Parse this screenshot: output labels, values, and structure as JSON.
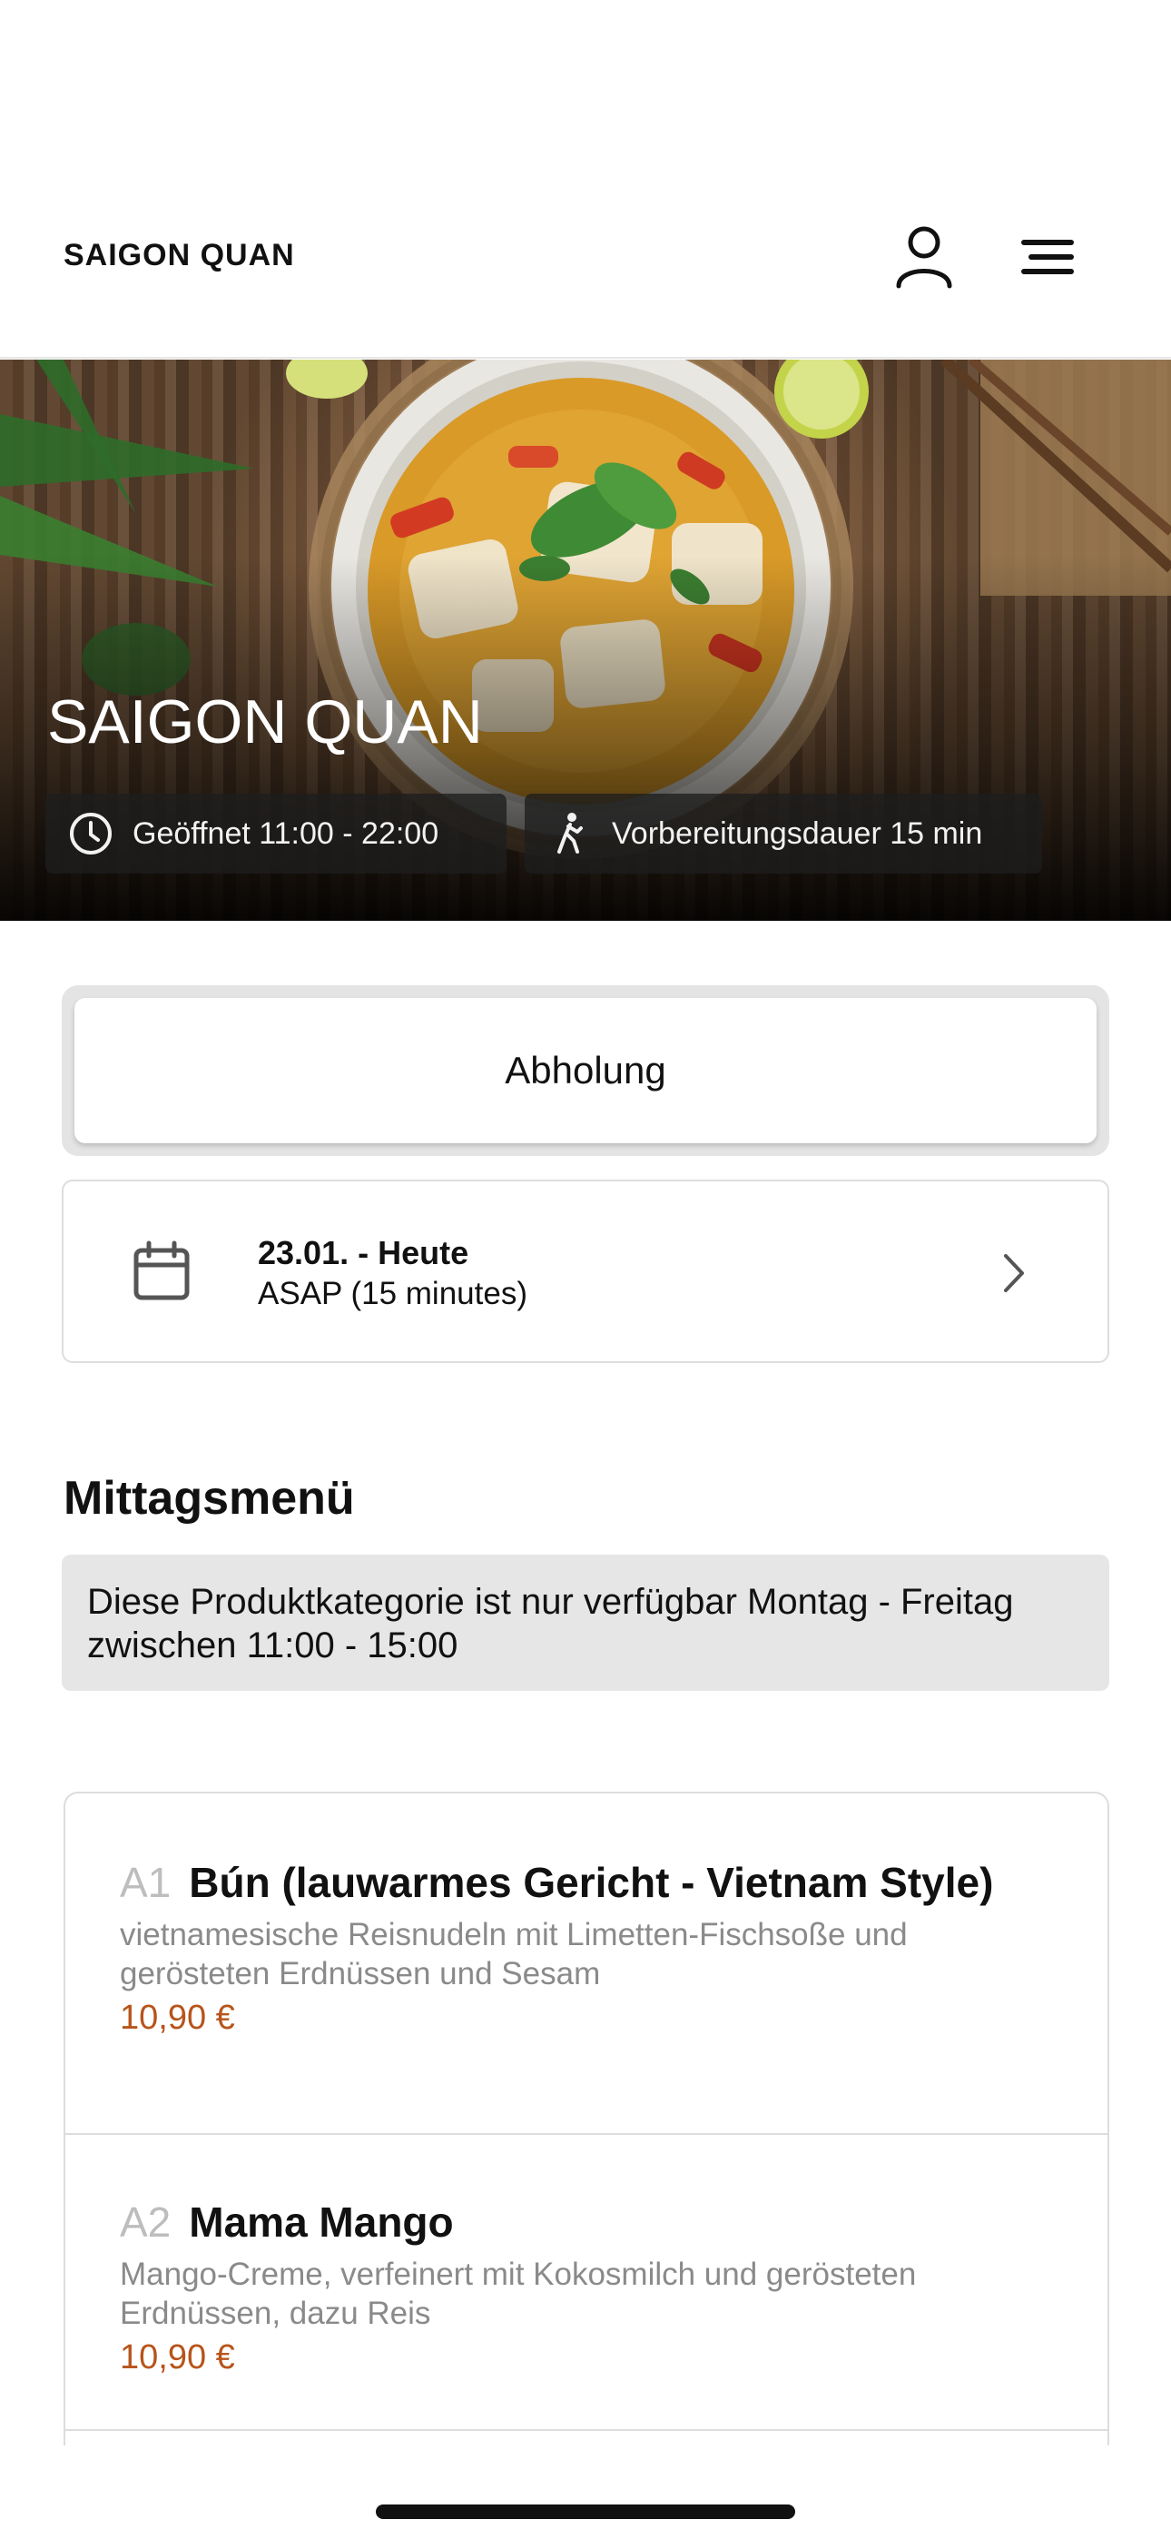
{
  "header": {
    "brand": "SAIGON QUAN",
    "icons": [
      "user-icon",
      "menu-icon"
    ]
  },
  "hero": {
    "title": "SAIGON QUAN",
    "open_hours": "Geöffnet 11:00 - 22:00",
    "prep_time": "Vorbereitungsdauer 15 min"
  },
  "order_mode": {
    "selected": "Abholung"
  },
  "schedule": {
    "date": "23.01. - Heute",
    "time": "ASAP (15 minutes)"
  },
  "category": {
    "title": "Mittagsmenü",
    "notice": "Diese Produktkategorie ist nur verfügbar Montag - Freitag zwischen 11:00 - 15:00"
  },
  "products": [
    {
      "code": "A1",
      "name": "Bún (lauwarmes Gericht - Vietnam Style)",
      "description": "vietnamesische Reisnudeln mit Limetten-Fischsoße und gerösteten Erdnüssen und Sesam",
      "price": "10,90 €"
    },
    {
      "code": "A2",
      "name": "Mama Mango",
      "description": "Mango-Creme, verfeinert mit Kokosmilch und gerösteten Erdnüssen, dazu Reis",
      "price": "10,90 €"
    }
  ],
  "colors": {
    "price": "#b7541b",
    "notice_bg": "#e6e6e6",
    "border": "#dddddd"
  }
}
